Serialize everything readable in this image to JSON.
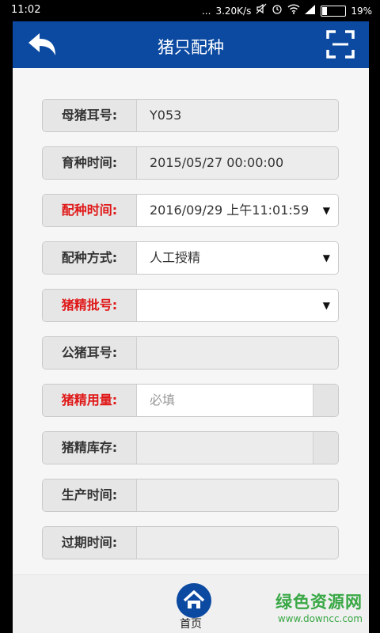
{
  "status_bar": {
    "time": "11:02",
    "dots": "...",
    "speed": "3.20K/s",
    "battery": "19%"
  },
  "header": {
    "title": "猪只配种"
  },
  "form": [
    {
      "label": "母猪耳号:",
      "value": "Y053",
      "required": false,
      "editable": false,
      "dropdown": false
    },
    {
      "label": "育种时间:",
      "value": "2015/05/27 00:00:00",
      "required": false,
      "editable": false,
      "dropdown": false
    },
    {
      "label": "配种时间:",
      "value": "2016/09/29 上午11:01:59",
      "required": true,
      "editable": true,
      "dropdown": true
    },
    {
      "label": "配种方式:",
      "value": "人工授精",
      "required": false,
      "editable": true,
      "dropdown": true
    },
    {
      "label": "猪精批号:",
      "value": "",
      "required": true,
      "editable": true,
      "dropdown": true
    },
    {
      "label": "公猪耳号:",
      "value": "",
      "required": false,
      "editable": false,
      "dropdown": false
    },
    {
      "label": "猪精用量:",
      "placeholder": "必填",
      "value": "",
      "required": true,
      "editable": true,
      "dropdown": false
    },
    {
      "label": "猪精库存:",
      "value": "",
      "required": false,
      "editable": false,
      "dropdown": false
    },
    {
      "label": "生产时间:",
      "value": "",
      "required": false,
      "editable": false,
      "dropdown": false
    },
    {
      "label": "过期时间:",
      "value": "",
      "required": false,
      "editable": false,
      "dropdown": false
    }
  ],
  "dropdown_arrow": "▼",
  "bottom_nav": {
    "home_label": "首页"
  },
  "watermark": {
    "main": "绿色资源网",
    "sub": "www.downcc.com"
  },
  "colors": {
    "primary": "#0c4aa2",
    "required": "#e01818",
    "watermark": "#39a845"
  },
  "icons": [
    "back-arrow-icon",
    "scan-icon",
    "home-icon",
    "wifi-icon",
    "signal-icon",
    "alarm-icon",
    "mute-icon",
    "battery-icon"
  ]
}
